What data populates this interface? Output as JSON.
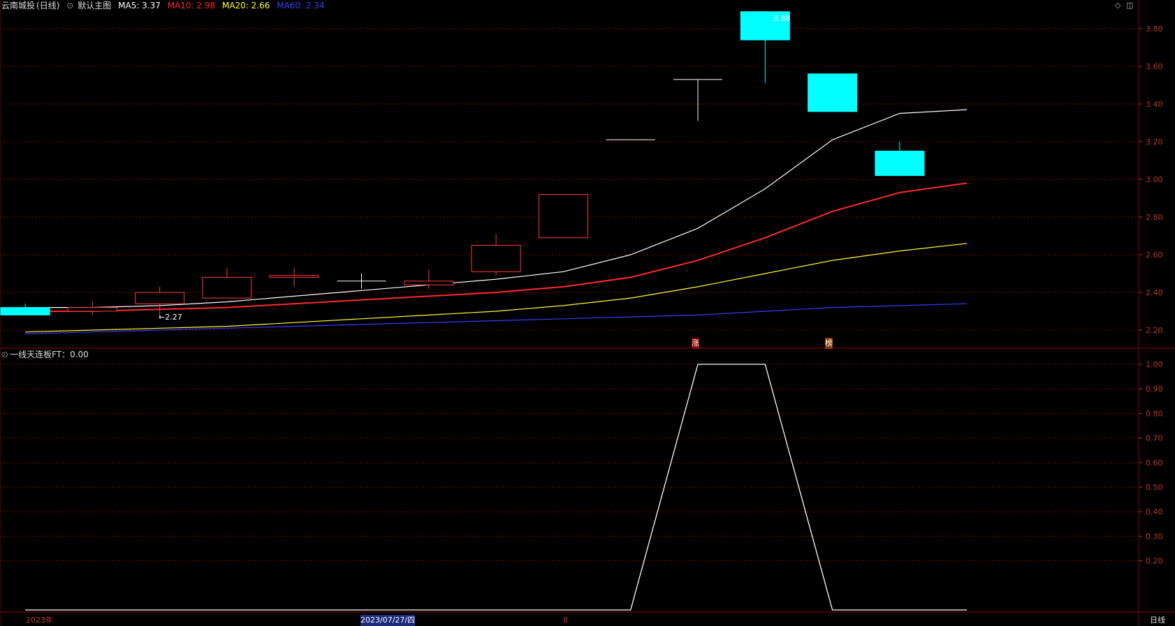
{
  "header": {
    "stock_name": "云南城投",
    "period_label": "(日线)",
    "template_label": "默认主图",
    "ma": [
      {
        "label": "MA5: 3.37",
        "color": "#ffffff"
      },
      {
        "label": "MA10: 2.98",
        "color": "#ff2a2a"
      },
      {
        "label": "MA20: 2.66",
        "color": "#ffff33"
      },
      {
        "label": "MA60: 2.34",
        "color": "#3b3bff"
      }
    ]
  },
  "sub_header": {
    "label": "一线天连板FT：0.00"
  },
  "bottom_bar": {
    "year_label": "2023年",
    "date_label": "2023/07/27/四",
    "marker_label": "8",
    "period_button": "日线"
  },
  "annotations": {
    "low_label": "←2.27",
    "high_label": "3.88",
    "tag_zhang": "涨",
    "tag_bang": "榜"
  },
  "colors": {
    "up": "#ff3b3b",
    "down": "#00ffff",
    "grid": "#8b0000",
    "axis": "#c0392b"
  },
  "chart_data": [
    {
      "type": "candlestick",
      "title": "",
      "ylim": [
        2.15,
        3.92
      ],
      "yticks": [
        "3.80",
        "3.60",
        "3.40",
        "3.20",
        "3.00",
        "2.80",
        "2.60",
        "2.40",
        "2.20"
      ],
      "candles": [
        {
          "o": 2.32,
          "h": 2.34,
          "l": 2.28,
          "c": 2.28
        },
        {
          "o": 2.3,
          "h": 2.35,
          "l": 2.28,
          "c": 2.32
        },
        {
          "o": 2.34,
          "h": 2.43,
          "l": 2.27,
          "c": 2.4
        },
        {
          "o": 2.37,
          "h": 2.53,
          "l": 2.37,
          "c": 2.48
        },
        {
          "o": 2.48,
          "h": 2.53,
          "l": 2.43,
          "c": 2.49
        },
        {
          "o": 2.46,
          "h": 2.5,
          "l": 2.42,
          "c": 2.46
        },
        {
          "o": 2.44,
          "h": 2.52,
          "l": 2.42,
          "c": 2.46
        },
        {
          "o": 2.51,
          "h": 2.71,
          "l": 2.49,
          "c": 2.65
        },
        {
          "o": 2.69,
          "h": 2.92,
          "l": 2.69,
          "c": 2.92
        },
        {
          "o": 3.21,
          "h": 3.21,
          "l": 3.21,
          "c": 3.21
        },
        {
          "o": 3.53,
          "h": 3.53,
          "l": 3.31,
          "c": 3.53
        },
        {
          "o": 3.89,
          "h": 3.89,
          "l": 3.51,
          "c": 3.74
        },
        {
          "o": 3.56,
          "h": 3.56,
          "l": 3.36,
          "c": 3.36
        },
        {
          "o": 3.15,
          "h": 3.2,
          "l": 3.02,
          "c": 3.02
        }
      ],
      "series": [
        {
          "name": "MA5",
          "color": "#ffffff",
          "values": [
            2.32,
            2.32,
            2.33,
            2.35,
            2.38,
            2.41,
            2.44,
            2.47,
            2.51,
            2.6,
            2.74,
            2.95,
            3.21,
            3.35,
            3.37
          ]
        },
        {
          "name": "MA10",
          "color": "#ff2a2a",
          "values": [
            2.3,
            2.3,
            2.31,
            2.32,
            2.34,
            2.36,
            2.38,
            2.4,
            2.43,
            2.48,
            2.57,
            2.69,
            2.83,
            2.93,
            2.98
          ]
        },
        {
          "name": "MA20",
          "color": "#ffff33",
          "values": [
            2.19,
            2.2,
            2.21,
            2.22,
            2.24,
            2.26,
            2.28,
            2.3,
            2.33,
            2.37,
            2.43,
            2.5,
            2.57,
            2.62,
            2.66
          ]
        },
        {
          "name": "MA60",
          "color": "#3b3bff",
          "values": [
            2.18,
            2.19,
            2.2,
            2.21,
            2.22,
            2.23,
            2.24,
            2.25,
            2.26,
            2.27,
            2.28,
            2.3,
            2.32,
            2.33,
            2.34
          ]
        }
      ]
    },
    {
      "type": "line",
      "title": "",
      "ylim": [
        0.0,
        1.05
      ],
      "yticks": [
        "1.00",
        "0.90",
        "0.80",
        "0.70",
        "0.60",
        "0.50",
        "0.40",
        "0.30",
        "0.20"
      ],
      "series": [
        {
          "name": "一线天连板FT",
          "color": "#ffffff",
          "values": [
            0,
            0,
            0,
            0,
            0,
            0,
            0,
            0,
            0,
            0,
            1,
            1,
            0,
            0,
            0
          ]
        }
      ]
    }
  ]
}
